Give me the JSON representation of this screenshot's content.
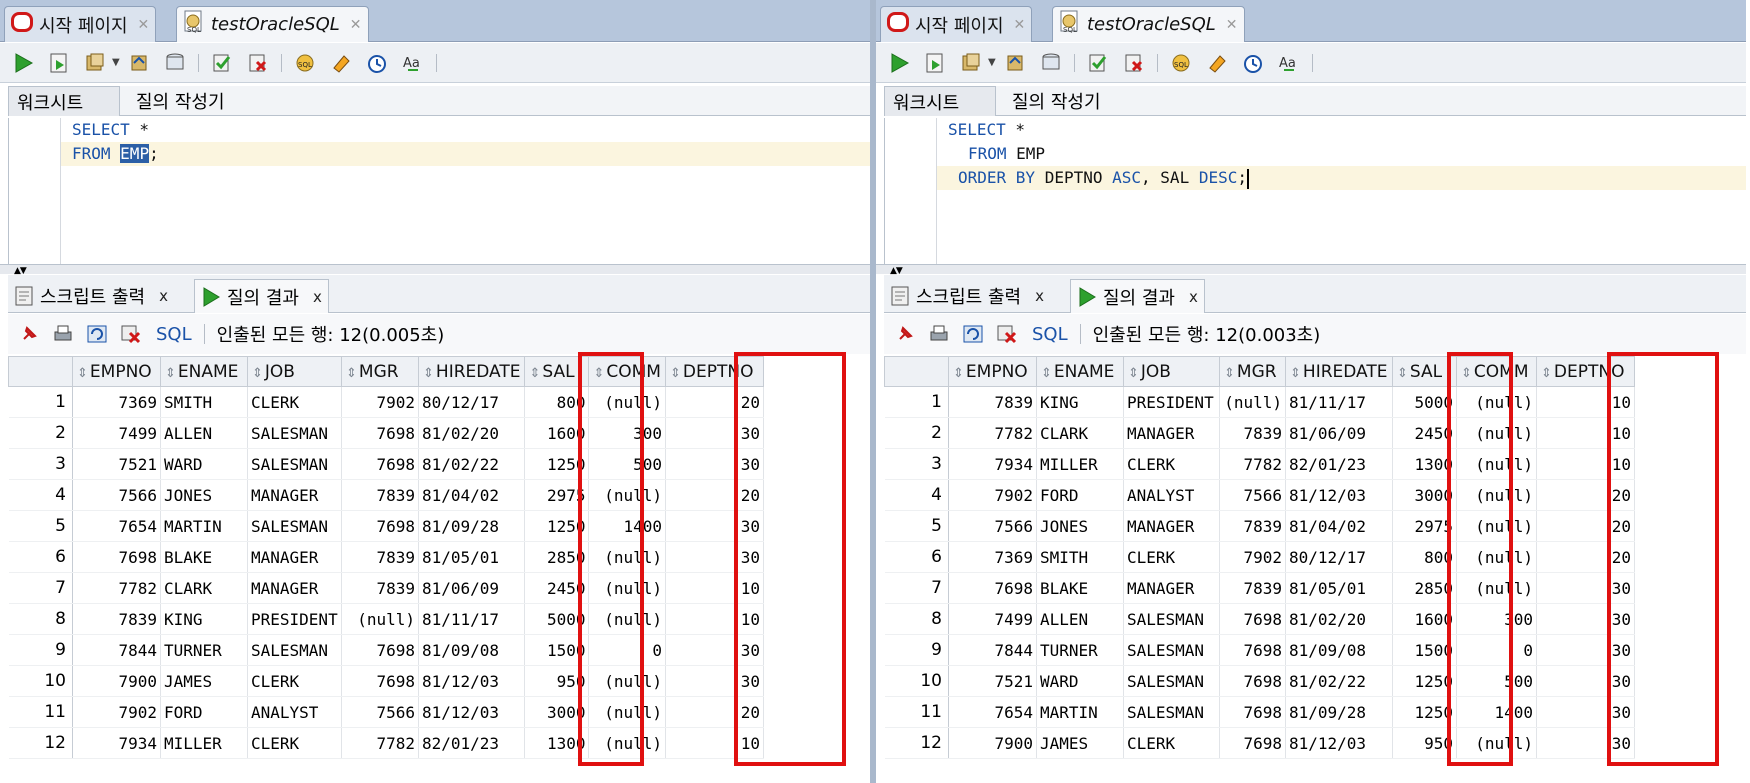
{
  "colors": {
    "accent": "#1a52a8",
    "highlight_box": "#e01010",
    "oracle_red": "#d01818"
  },
  "panels": [
    {
      "tabs": [
        {
          "label": "시작 페이지",
          "icon": "oracle-icon"
        },
        {
          "label": "testOracleSQL",
          "icon": "sql-file-icon"
        }
      ],
      "subtabs": {
        "worksheet": "워크시트",
        "query_builder": "질의 작성기"
      },
      "editor": {
        "line1": {
          "kw": "SELECT",
          "rest": " *"
        },
        "line2": {
          "kw": "FROM",
          "space": " ",
          "selected": "EMP",
          "rest": ";"
        }
      },
      "bottom_tabs": {
        "script_output": "스크립트 출력",
        "query_result": "질의 결과",
        "close": "x"
      },
      "result_toolbar": {
        "sql_label": "SQL",
        "status": "인출된 모든 행: 12(0.005초)"
      },
      "columns": [
        "EMPNO",
        "ENAME",
        "JOB",
        "MGR",
        "HIREDATE",
        "SAL",
        "COMM",
        "DEPTNO"
      ],
      "rows": [
        [
          "1",
          "7369",
          "SMITH",
          "CLERK",
          "7902",
          "80/12/17",
          "800",
          "(null)",
          "20"
        ],
        [
          "2",
          "7499",
          "ALLEN",
          "SALESMAN",
          "7698",
          "81/02/20",
          "1600",
          "300",
          "30"
        ],
        [
          "3",
          "7521",
          "WARD",
          "SALESMAN",
          "7698",
          "81/02/22",
          "1250",
          "500",
          "30"
        ],
        [
          "4",
          "7566",
          "JONES",
          "MANAGER",
          "7839",
          "81/04/02",
          "2975",
          "(null)",
          "20"
        ],
        [
          "5",
          "7654",
          "MARTIN",
          "SALESMAN",
          "7698",
          "81/09/28",
          "1250",
          "1400",
          "30"
        ],
        [
          "6",
          "7698",
          "BLAKE",
          "MANAGER",
          "7839",
          "81/05/01",
          "2850",
          "(null)",
          "30"
        ],
        [
          "7",
          "7782",
          "CLARK",
          "MANAGER",
          "7839",
          "81/06/09",
          "2450",
          "(null)",
          "10"
        ],
        [
          "8",
          "7839",
          "KING",
          "PRESIDENT",
          "(null)",
          "81/11/17",
          "5000",
          "(null)",
          "10"
        ],
        [
          "9",
          "7844",
          "TURNER",
          "SALESMAN",
          "7698",
          "81/09/08",
          "1500",
          "0",
          "30"
        ],
        [
          "10",
          "7900",
          "JAMES",
          "CLERK",
          "7698",
          "81/12/03",
          "950",
          "(null)",
          "30"
        ],
        [
          "11",
          "7902",
          "FORD",
          "ANALYST",
          "7566",
          "81/12/03",
          "3000",
          "(null)",
          "20"
        ],
        [
          "12",
          "7934",
          "MILLER",
          "CLERK",
          "7782",
          "82/01/23",
          "1300",
          "(null)",
          "10"
        ]
      ]
    },
    {
      "tabs": [
        {
          "label": "시작 페이지",
          "icon": "oracle-icon"
        },
        {
          "label": "testOracleSQL",
          "icon": "sql-file-icon"
        }
      ],
      "subtabs": {
        "worksheet": "워크시트",
        "query_builder": "질의 작성기"
      },
      "editor": {
        "line1": {
          "kw": "SELECT",
          "rest": " *"
        },
        "line2": {
          "kw": "FROM",
          "rest": " EMP"
        },
        "line3": {
          "kw1": "ORDER BY",
          "mid1": " DEPTNO ",
          "kw2": "ASC",
          "mid2": ", SAL ",
          "kw3": "DESC",
          "rest": ";"
        }
      },
      "bottom_tabs": {
        "script_output": "스크립트 출력",
        "query_result": "질의 결과",
        "close": "x"
      },
      "result_toolbar": {
        "sql_label": "SQL",
        "status": "인출된 모든 행: 12(0.003초)"
      },
      "columns": [
        "EMPNO",
        "ENAME",
        "JOB",
        "MGR",
        "HIREDATE",
        "SAL",
        "COMM",
        "DEPTNO"
      ],
      "rows": [
        [
          "1",
          "7839",
          "KING",
          "PRESIDENT",
          "(null)",
          "81/11/17",
          "5000",
          "(null)",
          "10"
        ],
        [
          "2",
          "7782",
          "CLARK",
          "MANAGER",
          "7839",
          "81/06/09",
          "2450",
          "(null)",
          "10"
        ],
        [
          "3",
          "7934",
          "MILLER",
          "CLERK",
          "7782",
          "82/01/23",
          "1300",
          "(null)",
          "10"
        ],
        [
          "4",
          "7902",
          "FORD",
          "ANALYST",
          "7566",
          "81/12/03",
          "3000",
          "(null)",
          "20"
        ],
        [
          "5",
          "7566",
          "JONES",
          "MANAGER",
          "7839",
          "81/04/02",
          "2975",
          "(null)",
          "20"
        ],
        [
          "6",
          "7369",
          "SMITH",
          "CLERK",
          "7902",
          "80/12/17",
          "800",
          "(null)",
          "20"
        ],
        [
          "7",
          "7698",
          "BLAKE",
          "MANAGER",
          "7839",
          "81/05/01",
          "2850",
          "(null)",
          "30"
        ],
        [
          "8",
          "7499",
          "ALLEN",
          "SALESMAN",
          "7698",
          "81/02/20",
          "1600",
          "300",
          "30"
        ],
        [
          "9",
          "7844",
          "TURNER",
          "SALESMAN",
          "7698",
          "81/09/08",
          "1500",
          "0",
          "30"
        ],
        [
          "10",
          "7521",
          "WARD",
          "SALESMAN",
          "7698",
          "81/02/22",
          "1250",
          "500",
          "30"
        ],
        [
          "11",
          "7654",
          "MARTIN",
          "SALESMAN",
          "7698",
          "81/09/28",
          "1250",
          "1400",
          "30"
        ],
        [
          "12",
          "7900",
          "JAMES",
          "CLERK",
          "7698",
          "81/12/03",
          "950",
          "(null)",
          "30"
        ]
      ]
    }
  ]
}
